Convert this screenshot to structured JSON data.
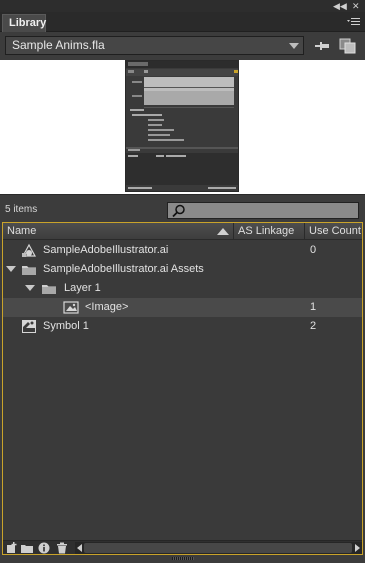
{
  "window": {
    "collapse_icon": "double-arrow-left-icon",
    "close_icon": "close-icon"
  },
  "panel": {
    "tab_label": "Library",
    "menu_icon": "panel-menu-icon"
  },
  "document": {
    "selected": "Sample Anims.fla",
    "pin_icon": "pin-icon",
    "new_library_icon": "new-library-panel-icon"
  },
  "status": {
    "item_count": "5 items",
    "search_placeholder": ""
  },
  "columns": {
    "name": "Name",
    "linkage": "AS Linkage",
    "use_count": "Use Count"
  },
  "items": [
    {
      "name": "SampleAdobeIllustrator.ai",
      "use_count": "0",
      "icon": "illustrator-asset-icon",
      "level": 0,
      "expandable": false,
      "selected": false
    },
    {
      "name": "SampleAdobeIllustrator.ai Assets",
      "use_count": "",
      "icon": "folder-icon",
      "level": 0,
      "expandable": true,
      "selected": false
    },
    {
      "name": "Layer 1",
      "use_count": "",
      "icon": "folder-icon",
      "level": 1,
      "expandable": true,
      "selected": false
    },
    {
      "name": "<Image>",
      "use_count": "1",
      "icon": "bitmap-icon",
      "level": 2,
      "expandable": false,
      "selected": true
    },
    {
      "name": "Symbol 1",
      "use_count": "2",
      "icon": "movieclip-symbol-icon",
      "level": 0,
      "expandable": false,
      "selected": false
    }
  ],
  "toolbar_icons": [
    "new-symbol-icon",
    "new-folder-icon",
    "properties-icon",
    "delete-icon"
  ],
  "colors": {
    "focus_border": "#c9a32a",
    "panel_bg": "#3c3c3c",
    "selected_row": "#4a4a4a"
  }
}
